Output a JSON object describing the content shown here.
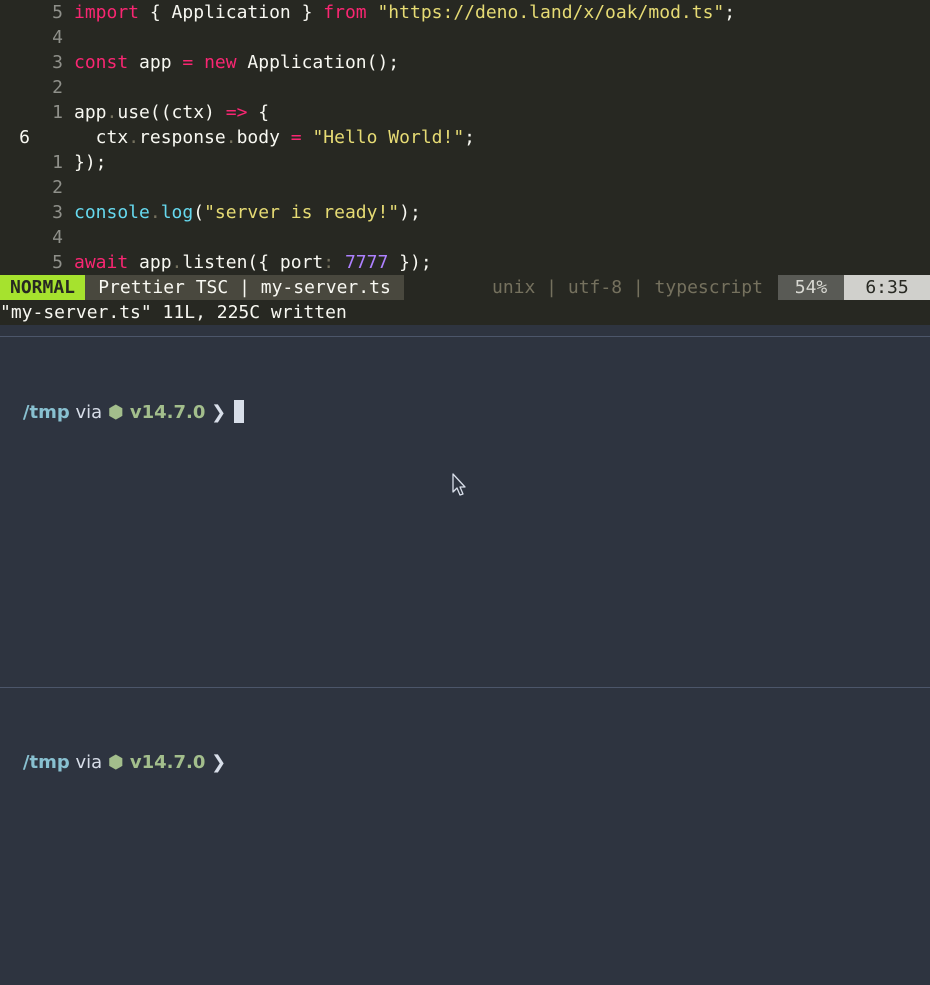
{
  "editor": {
    "lines": [
      {
        "num": "5",
        "current": false,
        "tokens": [
          {
            "t": "import",
            "c": "kw"
          },
          {
            "t": " { Application } ",
            "c": ""
          },
          {
            "t": "from",
            "c": "kw"
          },
          {
            "t": " ",
            "c": ""
          },
          {
            "t": "\"https://deno.land/x/oak/mod.ts\"",
            "c": "str"
          },
          {
            "t": ";",
            "c": ""
          }
        ]
      },
      {
        "num": "4",
        "current": false,
        "tokens": []
      },
      {
        "num": "3",
        "current": false,
        "tokens": [
          {
            "t": "const",
            "c": "kw"
          },
          {
            "t": " app ",
            "c": ""
          },
          {
            "t": "=",
            "c": "kw"
          },
          {
            "t": " ",
            "c": ""
          },
          {
            "t": "new",
            "c": "kw"
          },
          {
            "t": " Application();",
            "c": ""
          }
        ]
      },
      {
        "num": "2",
        "current": false,
        "tokens": []
      },
      {
        "num": "1",
        "current": false,
        "tokens": [
          {
            "t": "app",
            "c": ""
          },
          {
            "t": ".",
            "c": "dot"
          },
          {
            "t": "use((ctx) ",
            "c": ""
          },
          {
            "t": "=>",
            "c": "kw"
          },
          {
            "t": " {",
            "c": ""
          }
        ]
      },
      {
        "num": "6",
        "current": true,
        "tokens": [
          {
            "t": "  ctx",
            "c": ""
          },
          {
            "t": ".",
            "c": "dot"
          },
          {
            "t": "response",
            "c": ""
          },
          {
            "t": ".",
            "c": "dot"
          },
          {
            "t": "body ",
            "c": ""
          },
          {
            "t": "=",
            "c": "kw"
          },
          {
            "t": " ",
            "c": ""
          },
          {
            "t": "\"Hello World!\"",
            "c": "str"
          },
          {
            "t": ";",
            "c": ""
          }
        ]
      },
      {
        "num": "1",
        "current": false,
        "tokens": [
          {
            "t": "});",
            "c": ""
          }
        ]
      },
      {
        "num": "2",
        "current": false,
        "tokens": []
      },
      {
        "num": "3",
        "current": false,
        "tokens": [
          {
            "t": "console",
            "c": "blu"
          },
          {
            "t": ".",
            "c": "dot"
          },
          {
            "t": "log",
            "c": "blu"
          },
          {
            "t": "(",
            "c": ""
          },
          {
            "t": "\"server is ready!\"",
            "c": "str"
          },
          {
            "t": ");",
            "c": ""
          }
        ]
      },
      {
        "num": "4",
        "current": false,
        "tokens": []
      },
      {
        "num": "5",
        "current": false,
        "tokens": [
          {
            "t": "await",
            "c": "kw"
          },
          {
            "t": " app",
            "c": ""
          },
          {
            "t": ".",
            "c": "dot"
          },
          {
            "t": "listen({ port",
            "c": ""
          },
          {
            "t": ":",
            "c": "dot"
          },
          {
            "t": " ",
            "c": ""
          },
          {
            "t": "7777",
            "c": "num"
          },
          {
            "t": " });",
            "c": ""
          }
        ]
      }
    ]
  },
  "statusline": {
    "mode": "NORMAL",
    "file": "Prettier TSC | my-server.ts",
    "info": "unix | utf-8 | typescript",
    "percent": "54%",
    "position": "6:35"
  },
  "message": "\"my-server.ts\" 11L, 225C written",
  "terminal_top": {
    "dir": "/tmp",
    "via": " via ",
    "node_icon": "⬢",
    "node_version": " v14.7.0",
    "arrow": " ❯"
  },
  "terminal_bottom": {
    "dir": "/tmp",
    "via": " via ",
    "node_icon": "⬢",
    "node_version": " v14.7.0",
    "arrow": " ❯"
  },
  "colors": {
    "editor_bg": "#272822",
    "terminal_bg": "#2e3440",
    "mode_bg": "#a6e22e"
  },
  "icons": {
    "node": "hexagon-icon",
    "pointer": "mouse-pointer-icon"
  }
}
